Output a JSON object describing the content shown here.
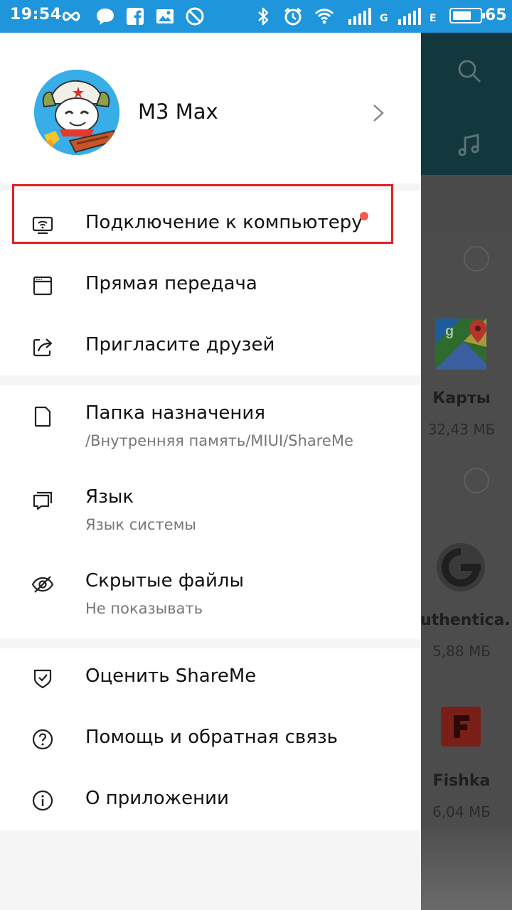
{
  "status_bar": {
    "time": "19:54",
    "battery_percent": "65",
    "sim1_letter": "G",
    "sim2_letter": "E"
  },
  "drawer": {
    "profile": {
      "name": "M3 Max"
    },
    "group1": [
      {
        "id": "pc-connect",
        "title": "Подключение к компьютеру",
        "icon": "monitor-wifi-icon",
        "has_dot": true
      },
      {
        "id": "direct-transfer",
        "title": "Прямая передача",
        "icon": "window-icon"
      },
      {
        "id": "invite",
        "title": "Пригласите друзей",
        "icon": "share-icon"
      }
    ],
    "group2": [
      {
        "id": "destination",
        "title": "Папка назначения",
        "subtitle": "/Внутренняя память/MIUI/ShareMe",
        "icon": "file-icon"
      },
      {
        "id": "language",
        "title": "Язык",
        "subtitle": "Язык системы",
        "icon": "chat-bubbles-icon"
      },
      {
        "id": "hidden",
        "title": "Скрытые файлы",
        "subtitle": "Не показывать",
        "icon": "eye-off-icon"
      }
    ],
    "group3": [
      {
        "id": "rate",
        "title": "Оценить ShareMe",
        "icon": "shield-check-icon"
      },
      {
        "id": "help",
        "title": "Помощь и обратная связь",
        "icon": "help-circle-icon"
      },
      {
        "id": "about",
        "title": "О приложении",
        "icon": "info-circle-icon"
      }
    ]
  },
  "background_app": {
    "apps": [
      {
        "name": "Карты",
        "size": "32,43 МБ"
      },
      {
        "name": "Authentica...",
        "size": "5,88 МБ"
      },
      {
        "name": "Fishka",
        "size": "6,04 МБ"
      }
    ]
  },
  "colors": {
    "status_bar": "#1f95dc",
    "highlight": "#e31e24",
    "notification_dot": "#f05a4f"
  }
}
